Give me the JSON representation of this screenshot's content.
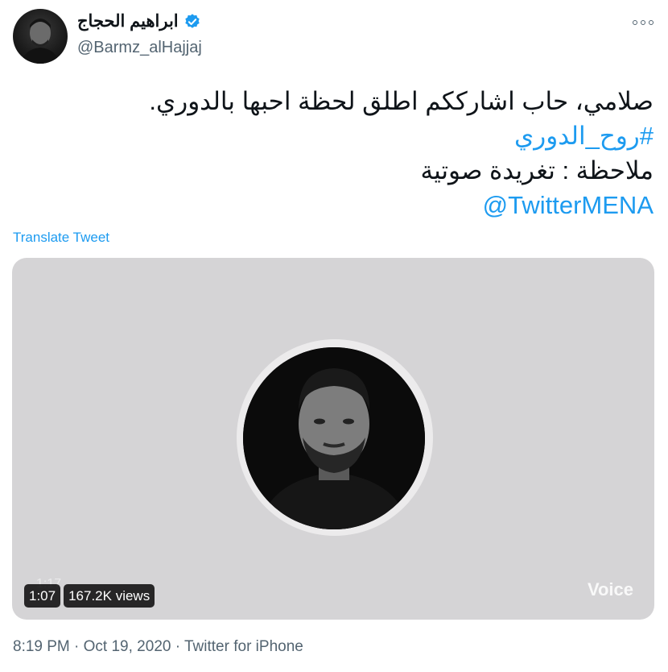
{
  "author": {
    "display_name": "ابراهيم الحجاج",
    "handle": "@Barmz_alHajjaj",
    "verified_icon": "verified-badge-icon",
    "more_icon": "more-icon"
  },
  "tweet": {
    "lines": [
      "صلامي، حاب اشارككم اطلق لحظة احبها بالدوري.",
      "#روح_الدوري",
      "ملاحظة : تغريدة صوتية",
      "@TwitterMENA"
    ],
    "translate_label": "Translate Tweet"
  },
  "media": {
    "duration": "1:07",
    "views": "167.2K views",
    "badge": "Voice",
    "waveform_text": "1:17",
    "background": "#d5d4d6"
  },
  "meta": {
    "time": "8:19 PM",
    "separator": "·",
    "date": "Oct 19, 2020",
    "source": "Twitter for iPhone"
  },
  "colors": {
    "link": "#1d9bf0",
    "text": "#0f1419",
    "secondary": "#536471"
  }
}
